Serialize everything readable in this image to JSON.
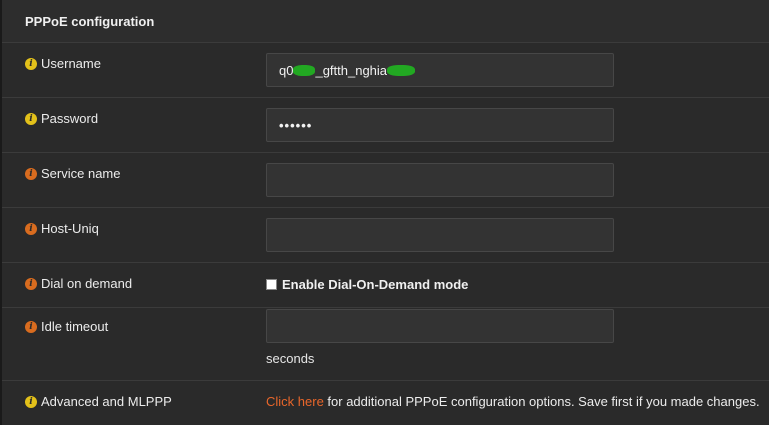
{
  "section": {
    "title": "PPPoE configuration"
  },
  "fields": {
    "username": {
      "label": "Username",
      "value_start": "q0",
      "value_mid": "_gftth_nghia"
    },
    "password": {
      "label": "Password",
      "value": "••••••"
    },
    "service_name": {
      "label": "Service name",
      "value": ""
    },
    "host_uniq": {
      "label": "Host-Uniq",
      "value": ""
    },
    "dial_on_demand": {
      "label": "Dial on demand",
      "checkbox_label": "Enable Dial-On-Demand mode",
      "checked": false
    },
    "idle_timeout": {
      "label": "Idle timeout",
      "value": "",
      "unit": "seconds"
    },
    "advanced": {
      "label": "Advanced and MLPPP",
      "link_text": "Click here",
      "text": " for additional PPPoE configuration options. Save first if you made changes."
    }
  },
  "icons": {
    "info_required": "info-icon-yellow",
    "info_optional": "info-icon-orange"
  },
  "colors": {
    "link": "#e8662a",
    "info_yellow": "#e3c11a",
    "info_orange": "#d96c1f"
  }
}
